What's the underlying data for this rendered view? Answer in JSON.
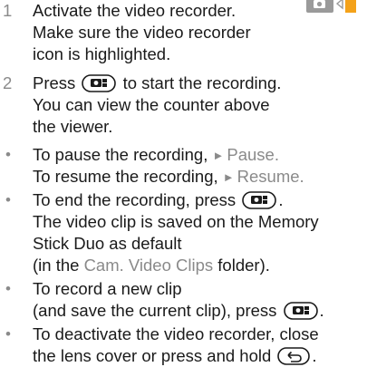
{
  "steps": [
    {
      "number": "1",
      "lines": [
        "Activate the video recorder.",
        "Make sure the video recorder",
        "icon is highlighted."
      ]
    },
    {
      "number": "2",
      "line1_a": "Press",
      "line1_b": "to start the recording.",
      "lines_rest": [
        "You can view the counter above",
        "the viewer."
      ]
    }
  ],
  "notes": {
    "pause_a": "To pause the recording,",
    "pause_b": "Pause",
    "resume_a": "To resume the recording,",
    "resume_b": "Resume",
    "end_a": "To end the recording, press",
    "end_line2": "The video clip is saved on the Memory",
    "end_line3": "Stick Duo as default",
    "end_line4_a": "(in the",
    "end_line4_b": "Cam. Video Clips",
    "end_line4_c": "folder).",
    "new_line1": "To record a new clip",
    "new_line2": "(and save the current clip), press",
    "deact_line1": "To deactivate the video recorder, close",
    "deact_line2": "the lens cover or press and hold"
  },
  "icons": {
    "camera_key": "camera-key-icon",
    "back_key": "back-key-icon",
    "mode_indicator": "camera-video-mode-icon"
  },
  "colors": {
    "accent_gray": "#8a8a8a",
    "text": "#1a1a1a",
    "highlight_orange": "#f4a21a"
  }
}
